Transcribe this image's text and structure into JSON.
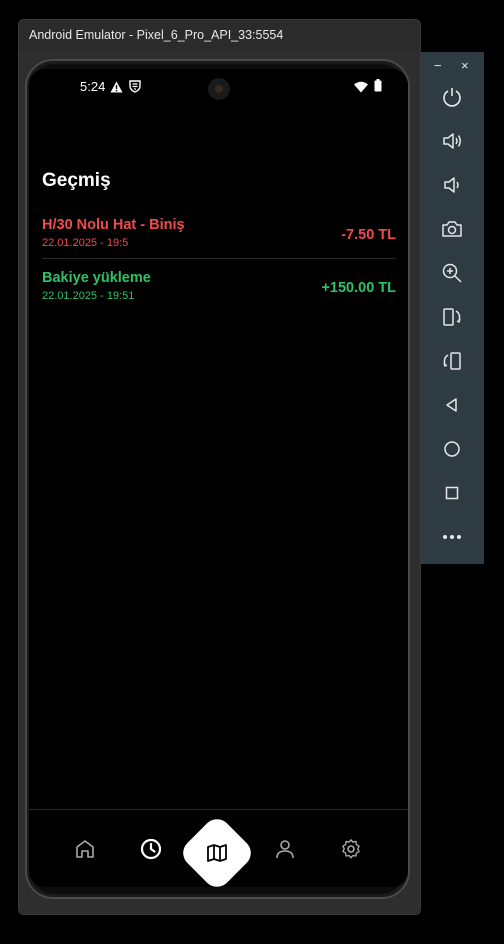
{
  "window": {
    "title": "Android Emulator - Pixel_6_Pro_API_33:5554",
    "minimize": "−",
    "close": "×"
  },
  "status_bar": {
    "time": "5:24"
  },
  "page": {
    "title": "Geçmiş"
  },
  "transactions": [
    {
      "title": "H/30 Nolu Hat - Biniş",
      "date": "22.01.2025 - 19:5",
      "amount": "-7.50 TL",
      "color": "#f04b4b"
    },
    {
      "title": "Bakiye yükleme",
      "date": "22.01.2025 - 19:51",
      "amount": "+150.00 TL",
      "color": "#2fc264"
    }
  ],
  "bottom_nav": [
    {
      "icon": "home-icon"
    },
    {
      "icon": "clock-icon",
      "active": true
    },
    {
      "icon": "map-icon",
      "center": true
    },
    {
      "icon": "person-icon"
    },
    {
      "icon": "settings-icon"
    }
  ],
  "toolbar": [
    "power-icon",
    "volume-up-icon",
    "volume-down-icon",
    "camera-icon",
    "zoom-icon",
    "rotate-left-icon",
    "rotate-right-icon",
    "back-icon",
    "home-circle-icon",
    "overview-icon",
    "more-icon"
  ]
}
